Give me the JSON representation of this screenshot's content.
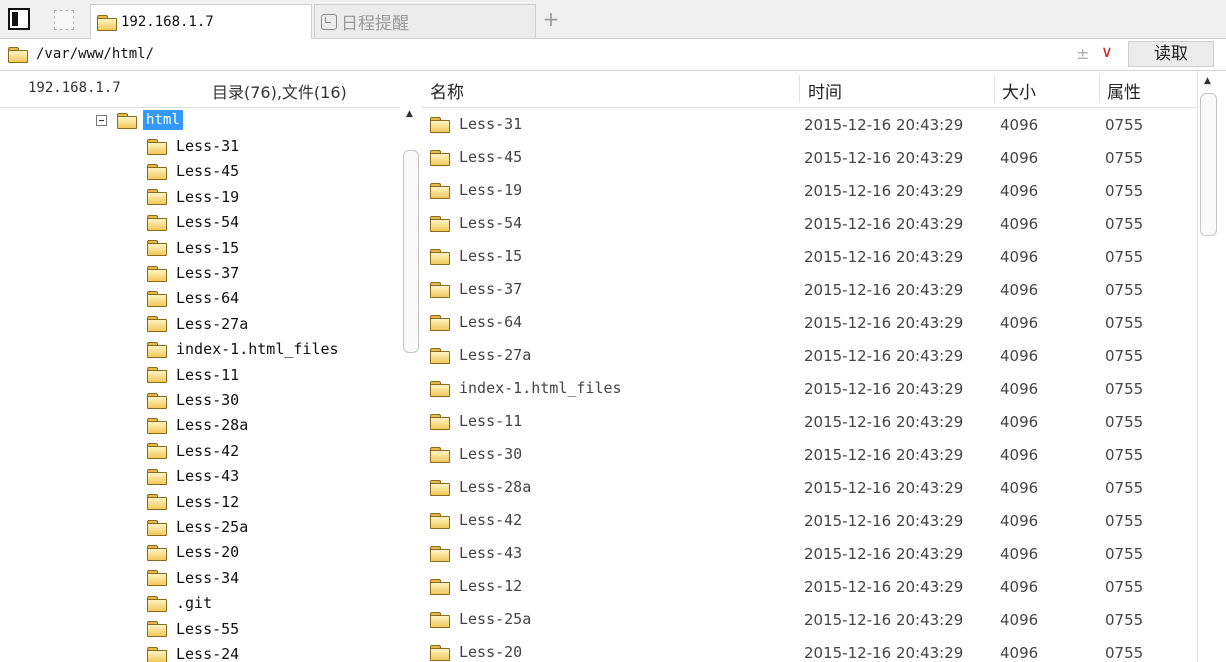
{
  "tabs": [
    {
      "label": "192.168.1.7",
      "icon": "folder-icon",
      "active": true
    },
    {
      "label": "日程提醒",
      "icon": "clock-icon",
      "active": false
    }
  ],
  "add_tab": "+",
  "pathbar": {
    "path": "/var/www/html/",
    "plusminus": "±",
    "dropdown": "∨",
    "read_button": "读取"
  },
  "left_pane": {
    "host": "192.168.1.7",
    "count": "目录(76),文件(16)",
    "root": "html",
    "items": [
      "Less-31",
      "Less-45",
      "Less-19",
      "Less-54",
      "Less-15",
      "Less-37",
      "Less-64",
      "Less-27a",
      "index-1.html_files",
      "Less-11",
      "Less-30",
      "Less-28a",
      "Less-42",
      "Less-43",
      "Less-12",
      "Less-25a",
      "Less-20",
      "Less-34",
      ".git",
      "Less-55",
      "Less-24"
    ]
  },
  "columns": {
    "name": "名称",
    "time": "时间",
    "size": "大小",
    "attr": "属性"
  },
  "files": [
    {
      "name": "Less-31",
      "time": "2015-12-16 20:43:29",
      "size": "4096",
      "attr": "0755"
    },
    {
      "name": "Less-45",
      "time": "2015-12-16 20:43:29",
      "size": "4096",
      "attr": "0755"
    },
    {
      "name": "Less-19",
      "time": "2015-12-16 20:43:29",
      "size": "4096",
      "attr": "0755"
    },
    {
      "name": "Less-54",
      "time": "2015-12-16 20:43:29",
      "size": "4096",
      "attr": "0755"
    },
    {
      "name": "Less-15",
      "time": "2015-12-16 20:43:29",
      "size": "4096",
      "attr": "0755"
    },
    {
      "name": "Less-37",
      "time": "2015-12-16 20:43:29",
      "size": "4096",
      "attr": "0755"
    },
    {
      "name": "Less-64",
      "time": "2015-12-16 20:43:29",
      "size": "4096",
      "attr": "0755"
    },
    {
      "name": "Less-27a",
      "time": "2015-12-16 20:43:29",
      "size": "4096",
      "attr": "0755"
    },
    {
      "name": "index-1.html_files",
      "time": "2015-12-16 20:43:29",
      "size": "4096",
      "attr": "0755"
    },
    {
      "name": "Less-11",
      "time": "2015-12-16 20:43:29",
      "size": "4096",
      "attr": "0755"
    },
    {
      "name": "Less-30",
      "time": "2015-12-16 20:43:29",
      "size": "4096",
      "attr": "0755"
    },
    {
      "name": "Less-28a",
      "time": "2015-12-16 20:43:29",
      "size": "4096",
      "attr": "0755"
    },
    {
      "name": "Less-42",
      "time": "2015-12-16 20:43:29",
      "size": "4096",
      "attr": "0755"
    },
    {
      "name": "Less-43",
      "time": "2015-12-16 20:43:29",
      "size": "4096",
      "attr": "0755"
    },
    {
      "name": "Less-12",
      "time": "2015-12-16 20:43:29",
      "size": "4096",
      "attr": "0755"
    },
    {
      "name": "Less-25a",
      "time": "2015-12-16 20:43:29",
      "size": "4096",
      "attr": "0755"
    },
    {
      "name": "Less-20",
      "time": "2015-12-16 20:43:29",
      "size": "4096",
      "attr": "0755"
    }
  ],
  "scroll": {
    "up_arrow": "▲"
  }
}
